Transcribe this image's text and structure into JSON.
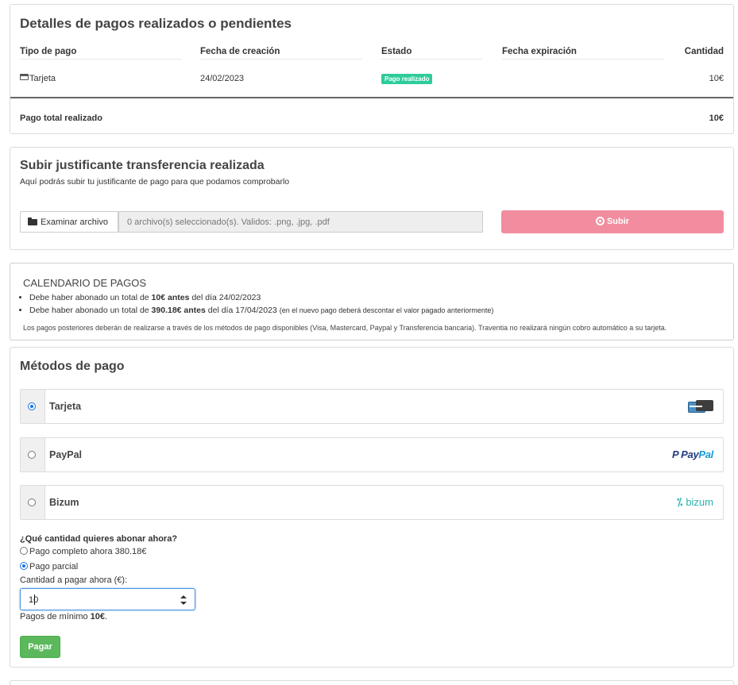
{
  "payment_details": {
    "title": "Detalles de pagos realizados o pendientes",
    "columns": [
      "Tipo de pago",
      "Fecha de creación",
      "Estado",
      "Fecha expiración",
      "Cantidad"
    ],
    "rows": [
      {
        "tipo": "Tarjeta",
        "fecha_creacion": "24/02/2023",
        "estado": "Pago realizado",
        "fecha_expiracion": "",
        "cantidad": "10€"
      }
    ],
    "total_label": "Pago total realizado",
    "total_value": "10€",
    "status_color": "#2ecc9a"
  },
  "upload": {
    "title": "Subir justificante transferencia realizada",
    "description": "Aquí podrás subir tu justificante de pago para que podamos comprobarlo",
    "browse_label": "Examinar archivo",
    "file_placeholder": "0 archivo(s) seleccionado(s). Validos: .png, .jpg, .pdf",
    "submit_label": "Subir",
    "submit_color": "#f28c9f"
  },
  "calendar": {
    "title": "CALENDARIO DE PAGOS",
    "items": [
      {
        "pre": "Debe haber abonado un total de ",
        "amount": "10€ antes",
        "post": " del día 24/02/2023",
        "note": ""
      },
      {
        "pre": "Debe haber abonado un total de ",
        "amount": "390.18€ antes",
        "post": " del día 17/04/2023",
        "note": "(en el nuevo pago deberá descontar el valor pagado anteriormente)"
      }
    ],
    "note": "Los pagos posteriores deberán de realizarse a través de los métodos de pago disponibles (Visa, Mastercard, Paypal y Transferencia bancaria). Traventia no realizará ningún cobro automático a su tarjeta."
  },
  "payment_methods": {
    "title": "Métodos de pago",
    "methods": [
      {
        "label": "Tarjeta",
        "selected": true,
        "logo": "credit-card-logo"
      },
      {
        "label": "PayPal",
        "selected": false,
        "logo": "paypal-logo",
        "logo_text_1": "Pay",
        "logo_text_2": "Pal"
      },
      {
        "label": "Bizum",
        "selected": false,
        "logo": "bizum-logo",
        "logo_text": "bizum"
      }
    ],
    "question": "¿Qué cantidad quieres abonar ahora?",
    "options": [
      {
        "label": "Pago completo ahora 380.18€",
        "selected": false
      },
      {
        "label": "Pago parcial",
        "selected": true
      }
    ],
    "amount_label": "Cantidad a pagar ahora (€):",
    "amount_value": "10",
    "min_pre": "Pagos de mínimo ",
    "min_amount": "10€",
    "min_post": ".",
    "pay_label": "Pagar",
    "pay_color": "#5cb85c"
  }
}
